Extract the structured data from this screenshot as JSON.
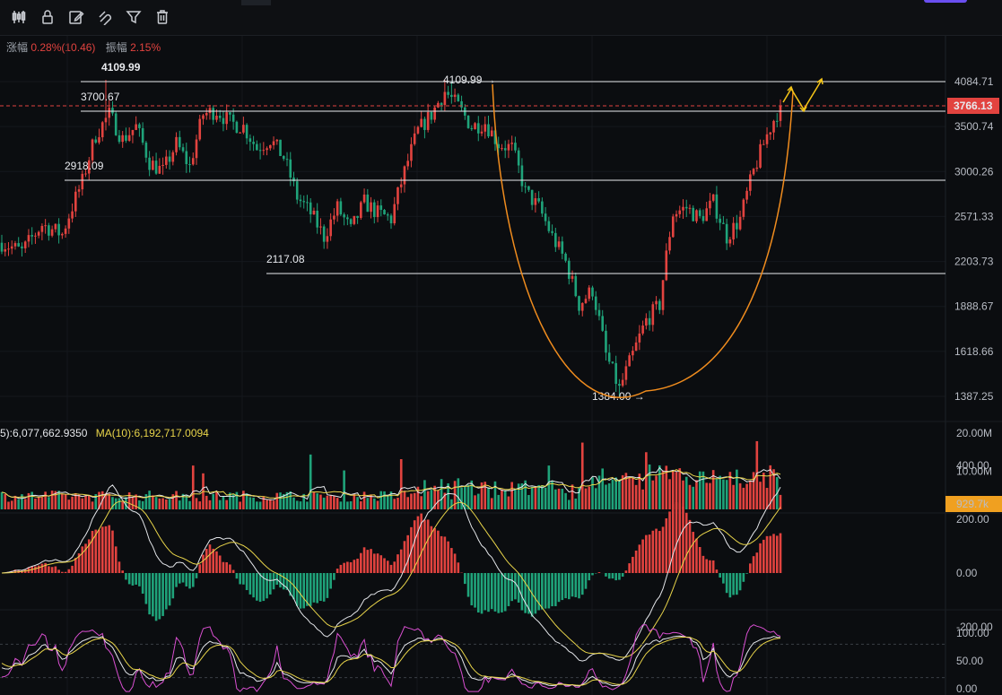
{
  "toolbar": {
    "tools": [
      {
        "name": "candlestick-tool",
        "icon": "candles-icon"
      },
      {
        "name": "lock-tool",
        "icon": "lock-icon"
      },
      {
        "name": "edit-tool",
        "icon": "edit-icon"
      },
      {
        "name": "magnet-tool",
        "icon": "magnet-icon"
      },
      {
        "name": "filter-tool",
        "icon": "filter-icon"
      },
      {
        "name": "delete-tool",
        "icon": "trash-icon"
      }
    ]
  },
  "stats": {
    "change_label": "涨幅",
    "change_value": "0.28%(10.46)",
    "amplitude_label": "振幅",
    "amplitude_value": "2.15%"
  },
  "colors": {
    "up": "#e2433f",
    "down": "#1fa37a",
    "price_tag": "#e2433f",
    "volume_tag": "#f0a020",
    "cup_curve": "#f08c1e",
    "arrow": "#f5c518",
    "ma_white": "#e4e6ea",
    "ma_yellow": "#e8d44a",
    "kdj_magenta": "#d94fd1"
  },
  "chart_data": {
    "type": "candlestick",
    "price_axis": {
      "ticks": [
        "4084.71",
        "3500.74",
        "3000.26",
        "2571.33",
        "2203.73",
        "1888.67",
        "1618.66",
        "1387.25"
      ],
      "current_price": "3766.13"
    },
    "levels": [
      {
        "value": "4109.99",
        "label": "4109.99"
      },
      {
        "value": "3700.67",
        "label": "3700.67"
      },
      {
        "value": "2918.09",
        "label": "2918.09"
      },
      {
        "value": "2117.08",
        "label": "2117.08"
      }
    ],
    "annotations": [
      {
        "text": "4109.99 →",
        "value": 4109.99
      },
      {
        "text": "1384.00 →",
        "value": 1384.0
      }
    ],
    "volume": {
      "legend_ma5": "5):6,077,662.9350",
      "legend_ma10": "MA(10):6,192,717.0094",
      "ticks": [
        "20.00M",
        "10.00M"
      ],
      "current": "929.7k"
    },
    "macd": {
      "ticks": [
        "400.00",
        "200.00",
        "0.00",
        "-200.00"
      ]
    },
    "kdj": {
      "ticks": [
        "100.00",
        "50.00",
        "0.00"
      ]
    },
    "price_keypoints": [
      [
        0,
        2350
      ],
      [
        6,
        2280
      ],
      [
        12,
        2500
      ],
      [
        18,
        2420
      ],
      [
        24,
        2900
      ],
      [
        28,
        3400
      ],
      [
        32,
        3650
      ],
      [
        36,
        3350
      ],
      [
        40,
        3500
      ],
      [
        44,
        3100
      ],
      [
        48,
        3000
      ],
      [
        52,
        3300
      ],
      [
        56,
        3050
      ],
      [
        60,
        3650
      ],
      [
        64,
        3700
      ],
      [
        68,
        3550
      ],
      [
        72,
        3500
      ],
      [
        76,
        3250
      ],
      [
        80,
        3350
      ],
      [
        84,
        3150
      ],
      [
        88,
        2750
      ],
      [
        92,
        2600
      ],
      [
        96,
        2400
      ],
      [
        100,
        2650
      ],
      [
        104,
        2450
      ],
      [
        108,
        2700
      ],
      [
        112,
        2600
      ],
      [
        116,
        2550
      ],
      [
        120,
        3000
      ],
      [
        124,
        3450
      ],
      [
        128,
        3650
      ],
      [
        132,
        3950
      ],
      [
        136,
        3750
      ],
      [
        140,
        3500
      ],
      [
        144,
        3550
      ],
      [
        148,
        3300
      ],
      [
        152,
        3250
      ],
      [
        156,
        2800
      ],
      [
        160,
        2650
      ],
      [
        164,
        2400
      ],
      [
        168,
        2200
      ],
      [
        172,
        1900
      ],
      [
        176,
        2000
      ],
      [
        180,
        1600
      ],
      [
        184,
        1420
      ],
      [
        188,
        1600
      ],
      [
        192,
        1800
      ],
      [
        196,
        1900
      ],
      [
        200,
        2600
      ],
      [
        204,
        2650
      ],
      [
        208,
        2550
      ],
      [
        212,
        2700
      ],
      [
        216,
        2400
      ],
      [
        220,
        2550
      ],
      [
        224,
        3000
      ],
      [
        228,
        3400
      ],
      [
        232,
        3766
      ]
    ],
    "candle_count": 233
  }
}
